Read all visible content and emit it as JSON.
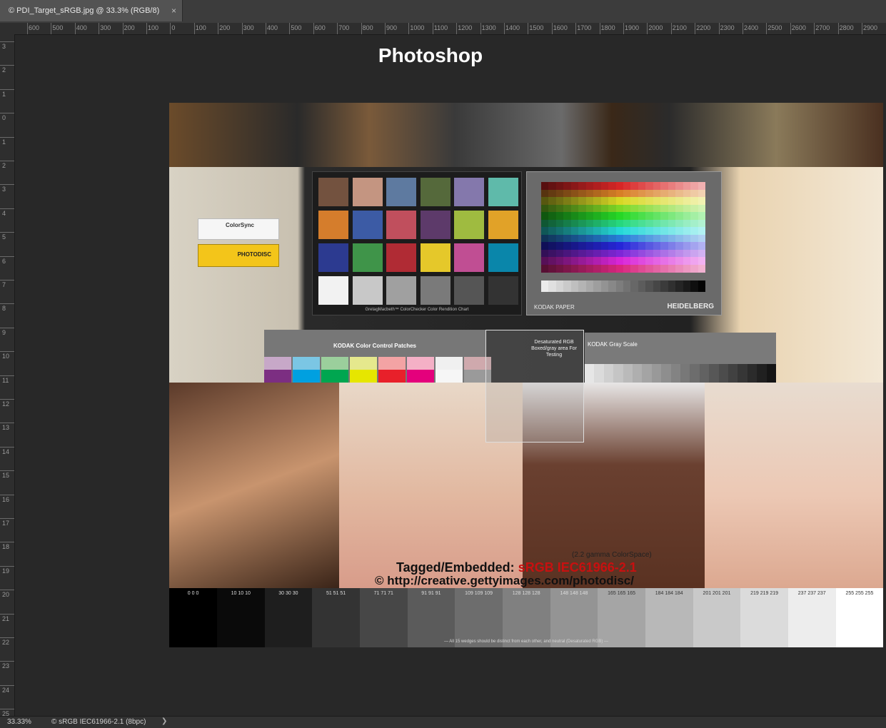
{
  "tab": {
    "label": "© PDI_Target_sRGB.jpg @ 33.3% (RGB/8)",
    "close": "×"
  },
  "ruler_top_labels": [
    "600",
    "500",
    "400",
    "300",
    "200",
    "100",
    "0",
    "100",
    "200",
    "300",
    "400",
    "500",
    "600",
    "700",
    "800",
    "900",
    "1000",
    "1100",
    "1200",
    "1300",
    "1400",
    "1500",
    "1600",
    "1700",
    "1800",
    "1900",
    "2000",
    "2100",
    "2200",
    "2300",
    "2400",
    "2500",
    "2600",
    "2700",
    "2800",
    "2900"
  ],
  "ruler_left_labels": [
    "3",
    "2",
    "1",
    "0",
    "1",
    "2",
    "3",
    "4",
    "5",
    "6",
    "7",
    "8",
    "9",
    "10",
    "11",
    "12",
    "13",
    "14",
    "15",
    "16",
    "17",
    "18",
    "19",
    "20",
    "21",
    "22",
    "23",
    "24",
    "25"
  ],
  "page_title": "Photoshop",
  "image": {
    "colorsync_label": "ColorSync",
    "photodisc_label": "PHOTODISC",
    "checker_caption": "GretagMacbeth™ ColorChecker Color Rendition Chart",
    "checker_colors": [
      "#73523f",
      "#c49581",
      "#5e7aa0",
      "#55693b",
      "#8478ac",
      "#5fbaaa",
      "#d57d2c",
      "#3c5ba5",
      "#c04f5d",
      "#5d3a6a",
      "#9fbb40",
      "#e1a228",
      "#2c3a90",
      "#3f9449",
      "#b02b34",
      "#e5c82a",
      "#c04e93",
      "#0a86aa",
      "#f2f2f2",
      "#c8c8c8",
      "#a0a0a0",
      "#7a7a7a",
      "#555555",
      "#333333"
    ],
    "it8_kodak": "KODAK PAPER",
    "it8_heidel": "HEIDELBERG",
    "kodak_strip_title": "KODAK Color Control Patches",
    "kodak_strip_colors": [
      "#c7a8c8",
      "#7bc6e4",
      "#9bcf9c",
      "#e5e88d",
      "#f3a3a4",
      "#f4b0c6",
      "#f0f0f0",
      "#cfa9ad"
    ],
    "kodak_strip_colors2": [
      "#7c2e82",
      "#00a0e0",
      "#00a650",
      "#e6e600",
      "#e8202a",
      "#e4007c",
      "#f6f6f6",
      "#9a9a9a"
    ],
    "gray_scale_title": "KODAK Gray Scale",
    "desat_text": "Desaturated RGB Boxed/gray area For Testing",
    "gamma_text": "(2.2 gamma ColorSpace)",
    "tag_prefix": "Tagged/Embedded: ",
    "tag_profile": "sRGB IEC61966-2.1",
    "url_text": "© http://creative.gettyimages.com/photodisc/",
    "wedge_labels": [
      "0 0 0",
      "10 10 10",
      "30 30 30",
      "51 51 51",
      "71 71 71",
      "91 91 91",
      "109 109 109",
      "128 128 128",
      "148 148 148",
      "165 165 165",
      "184 184 184",
      "201 201 201",
      "219 219 219",
      "237 237 237",
      "255 255 255"
    ],
    "wedge_colors": [
      "#000000",
      "#0a0a0a",
      "#1e1e1e",
      "#333333",
      "#474747",
      "#5b5b5b",
      "#6d6d6d",
      "#808080",
      "#949494",
      "#a5a5a5",
      "#b8b8b8",
      "#c9c9c9",
      "#dbdbdb",
      "#ededed",
      "#ffffff"
    ],
    "wedge_footer": "— All 15 wedges should be distinct from each other, and neutral (Desaturated RGB) —"
  },
  "status": {
    "zoom": "33.33%",
    "profile": "© sRGB IEC61966-2.1 (8bpc)",
    "more": "❯"
  }
}
